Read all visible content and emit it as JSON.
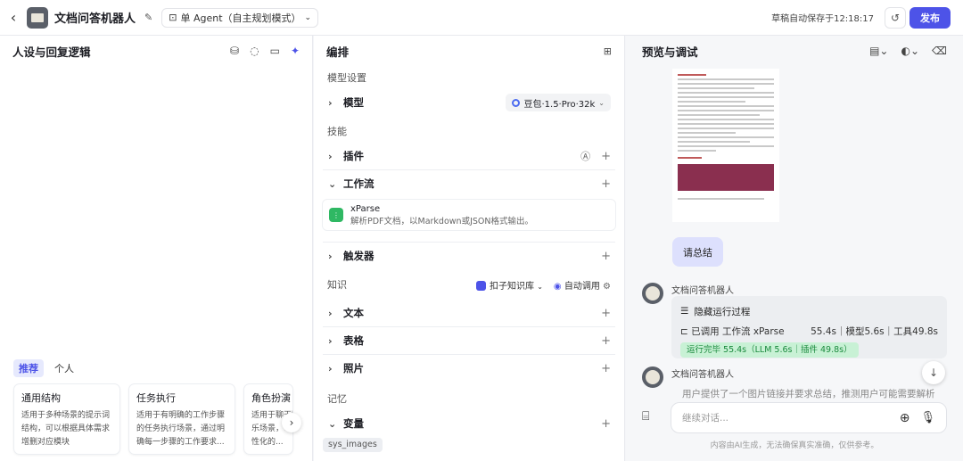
{
  "header": {
    "bot_name": "文档问答机器人",
    "agent_mode": "单 Agent（自主规划模式）",
    "draft_status": "草稿自动保存于12:18:17",
    "publish_label": "发布"
  },
  "persona_panel": {
    "title": "人设与回复逻辑",
    "tabs": [
      {
        "label": "推荐"
      },
      {
        "label": "个人"
      }
    ],
    "cards": [
      {
        "title": "通用结构",
        "desc": "适用于多种场景的提示词结构，可以根据具体需求增删对应模块"
      },
      {
        "title": "任务执行",
        "desc": "适用于有明确的工作步骤的任务执行场景，通过明确每一步骤的工作要求..."
      },
      {
        "title": "角色扮演",
        "desc": "适用于聊天陪伴、互动娱乐场景，可帮助你塑造个性化的..."
      }
    ]
  },
  "arrange_panel": {
    "title": "编排",
    "model_section": "模型设置",
    "model_label": "模型",
    "model_value": "豆包·1.5·Pro·32k",
    "skills_section": "技能",
    "plugin_label": "插件",
    "workflow_label": "工作流",
    "workflow_item": {
      "name": "xParse",
      "desc": "解析PDF文档，以Markdown或JSON格式输出。"
    },
    "trigger_label": "触发器",
    "knowledge_section": "知识",
    "kb_source": "扣子知识库",
    "kb_mode": "自动调用",
    "text_label": "文本",
    "table_label": "表格",
    "photo_label": "照片",
    "memory_section": "记忆",
    "variable_label": "变量",
    "variable_tag": "sys_images"
  },
  "preview_panel": {
    "title": "预览与调试",
    "user_message": "请总结",
    "bot_name": "文档问答机器人",
    "trace_toggle": "隐藏运行过程",
    "trace_called": "已调用 工作流 xParse",
    "trace_timing": "55.4s｜模型5.6s｜工具49.8s",
    "trace_status": "运行完毕 55.4s（LLM 5.6s｜插件 49.8s）",
    "answer_text": "用户提供了一个图片链接并要求总结，推测用户可能需要解析",
    "input_placeholder": "继续对话...",
    "footnote": "内容由AI生成，无法确保真实准确，仅供参考。"
  }
}
